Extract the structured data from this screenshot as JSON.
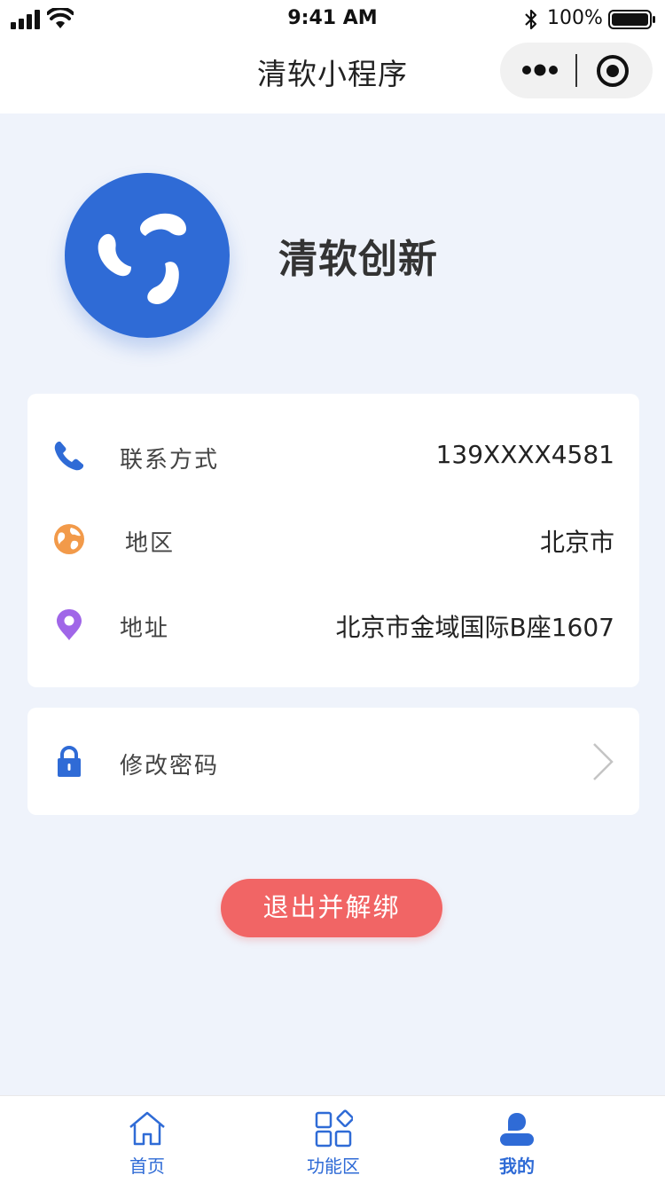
{
  "status_bar": {
    "time": "9:41 AM",
    "battery_percent": "100%",
    "battery_level": 1.0
  },
  "nav": {
    "title": "清软小程序",
    "more_icon": "more-dots-icon",
    "close_icon": "target-circle-icon"
  },
  "profile": {
    "avatar_icon": "pinwheel-logo-icon",
    "name": "清软创新"
  },
  "info": {
    "rows": [
      {
        "icon": "phone-icon",
        "label": "联系方式",
        "value": "139XXXX4581"
      },
      {
        "icon": "globe-icon",
        "label": "地区",
        "value": "北京市"
      },
      {
        "icon": "location-pin-icon",
        "label": "地址",
        "value": "北京市金域国际B座1607"
      }
    ]
  },
  "password": {
    "icon": "lock-icon",
    "label": "修改密码",
    "chevron_icon": "chevron-right-icon"
  },
  "logout": {
    "label": "退出并解绑"
  },
  "tabbar": {
    "tabs": [
      {
        "icon": "home-icon",
        "label": "首页",
        "active": false
      },
      {
        "icon": "grid-icon",
        "label": "功能区",
        "active": false
      },
      {
        "icon": "user-icon",
        "label": "我的",
        "active": true
      }
    ]
  },
  "colors": {
    "accent": "#2f6bd6",
    "page_bg": "#eff3fb",
    "logout": "#f16565",
    "globe": "#f29a4a",
    "pin": "#a066e8"
  }
}
